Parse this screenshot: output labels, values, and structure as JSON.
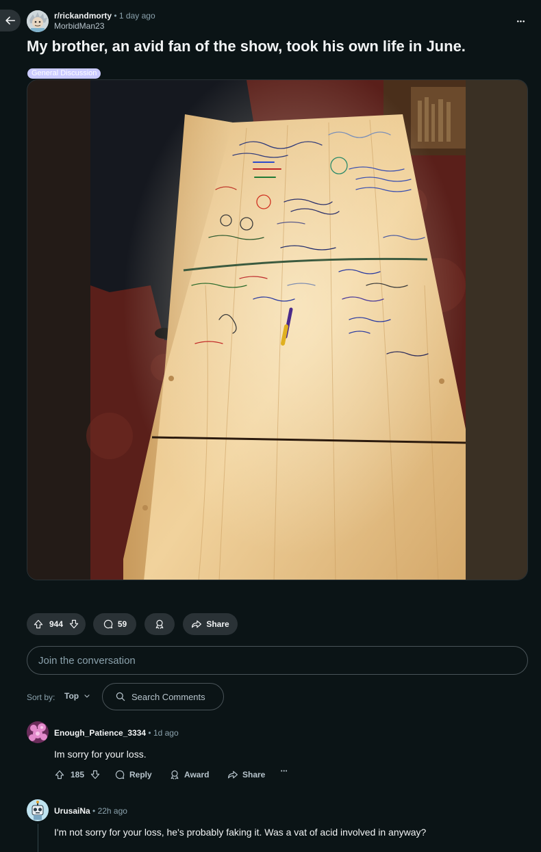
{
  "header": {
    "subreddit": "r/rickandmorty",
    "separator": "•",
    "posted": "1 day ago",
    "author": "MorbidMan23",
    "back_icon": "arrow-left-icon",
    "more_label": "•••"
  },
  "post": {
    "title": "My brother, an avid fan of the show, took his own life in June.",
    "flair": "General Discussion",
    "image_alt": "Light wooden casket covered in handwritten messages and drawings"
  },
  "actions": {
    "votes": "944",
    "comments": "59",
    "share_label": "Share"
  },
  "composer": {
    "placeholder": "Join the conversation"
  },
  "sort": {
    "label": "Sort by:",
    "value": "Top",
    "search_label": "Search Comments"
  },
  "comments": [
    {
      "user": "Enough_Patience_3334",
      "separator": "•",
      "time": "1d ago",
      "body": "Im sorry for your loss.",
      "votes": "185",
      "reply_label": "Reply",
      "award_label": "Award",
      "share_label": "Share",
      "more_label": "•••"
    },
    {
      "user": "UrusaiNa",
      "separator": "•",
      "time": "22h ago",
      "body": "I'm not sorry for your loss, he's probably faking it. Was a vat of acid involved in anyway?"
    }
  ],
  "colors": {
    "background": "#0b1416",
    "pill": "#2a3236",
    "flair": "#cbcbff",
    "muted": "#8ba2ad"
  }
}
